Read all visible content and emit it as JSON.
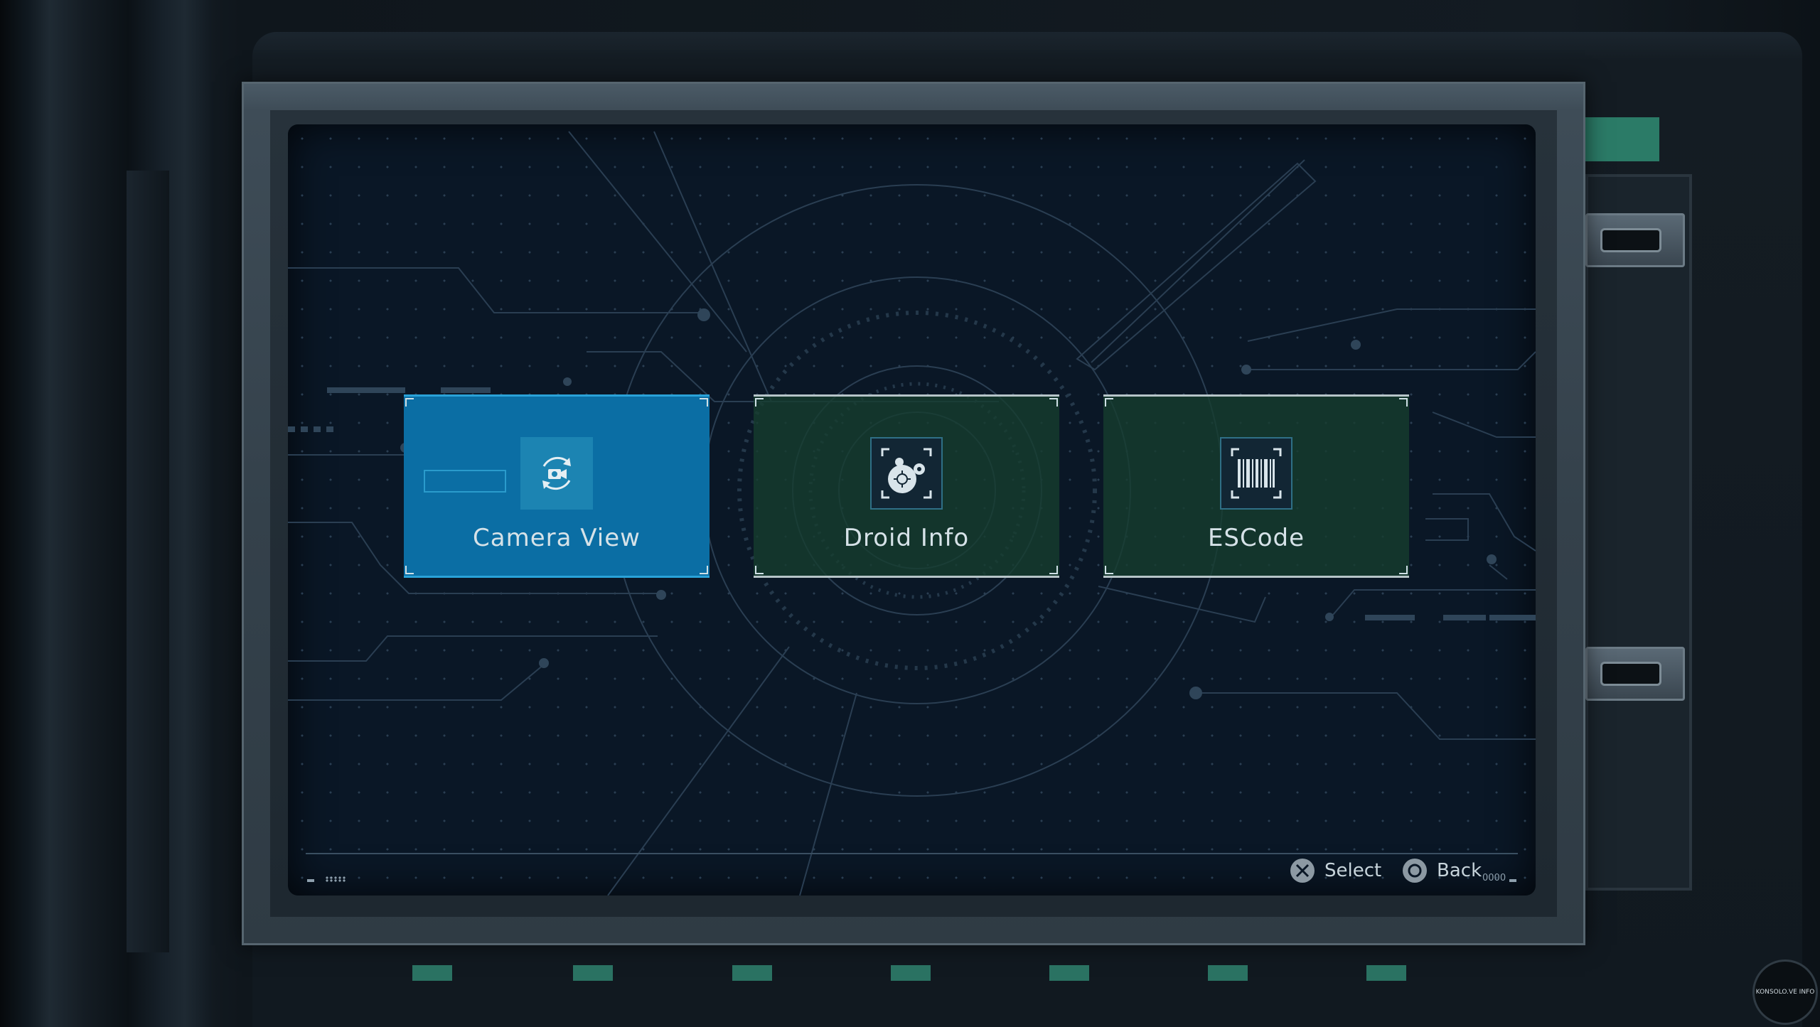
{
  "menu": {
    "items": [
      {
        "label": "Camera View",
        "icon": "camera-rotate-icon",
        "selected": true
      },
      {
        "label": "Droid Info",
        "icon": "droid-icon",
        "selected": false
      },
      {
        "label": "ESCode",
        "icon": "barcode-icon",
        "selected": false
      }
    ]
  },
  "footer": {
    "select_label": "Select",
    "select_icon": "cross-button-icon",
    "back_label": "Back",
    "back_icon": "circle-button-icon",
    "code": "0000"
  },
  "watermark": {
    "text": "KONSOLO.VE INFO"
  },
  "colors": {
    "selected_card": "#0b6ea4",
    "normal_card": "#163e2e",
    "screen_bg": "#0a1726",
    "indicator_green": "#2a7262"
  }
}
